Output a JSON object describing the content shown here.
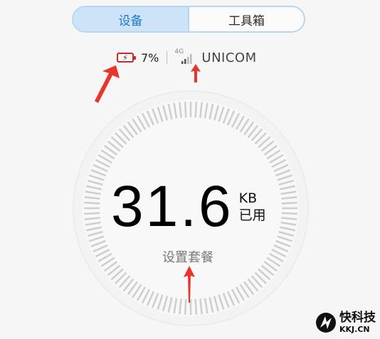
{
  "tabs": [
    {
      "label": "设备",
      "active": true
    },
    {
      "label": "工具箱",
      "active": false
    }
  ],
  "status": {
    "battery_percent": "7%",
    "network_type": "4G",
    "carrier": "UNICOM"
  },
  "usage": {
    "value": "31.6",
    "unit": "KB",
    "unit_caption": "已用",
    "set_plan_label": "设置套餐"
  },
  "watermark": {
    "name": "快科技",
    "domain": "KKJ.CN"
  },
  "colors": {
    "accent": "#1a78d4",
    "tab_active_bg": "#cde3f8",
    "battery_low": "#c72a2a",
    "annotation_arrow": "#e8352b"
  }
}
